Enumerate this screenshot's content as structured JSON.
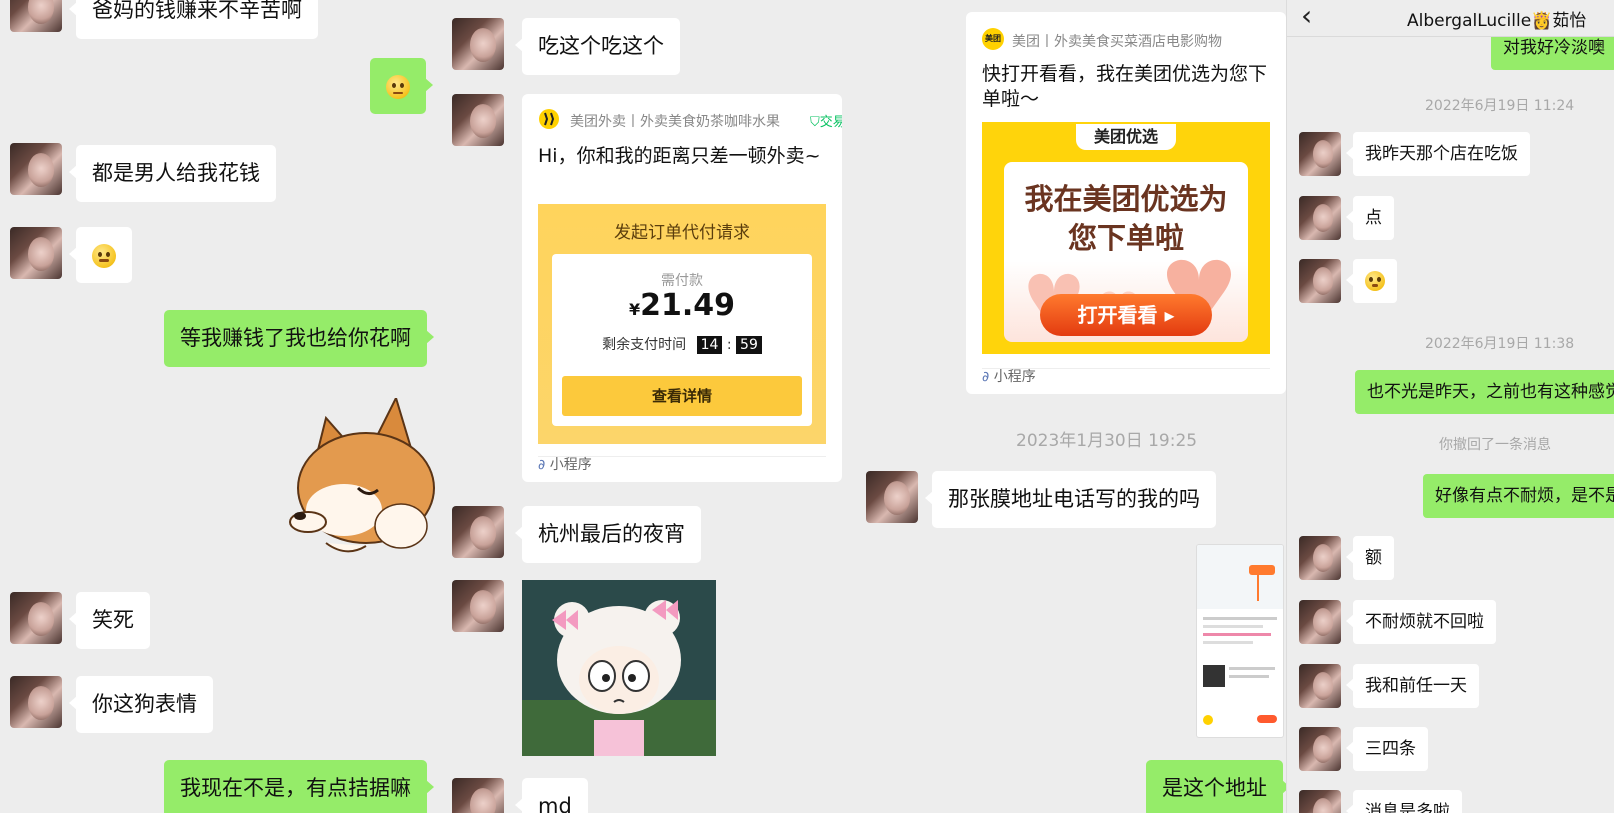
{
  "col1": {
    "messages": [
      {
        "text": "爸妈的钱赚来不辛苦啊"
      },
      {
        "text": "😕"
      },
      {
        "text": "都是男人给我花钱"
      },
      {
        "text": "🙂"
      },
      {
        "text": "等我赚钱了我也给你花啊"
      },
      {
        "text": "笑死"
      },
      {
        "text": "你这狗表情"
      },
      {
        "text": "我现在不是，有点拮据嘛"
      }
    ]
  },
  "col2": {
    "messages": [
      {
        "text": "吃这个吃这个"
      },
      {
        "text": "杭州最后的夜宵"
      },
      {
        "text": "md"
      }
    ],
    "card": {
      "source": "美团外卖丨外卖美食奶茶咖啡水果",
      "verified": "交易",
      "title": "Hi，你和我的距离只差一顿外卖~",
      "panel_title": "发起订单代付请求",
      "amount_label": "需付款",
      "currency": "¥",
      "amount": "21.49",
      "time_label": "剩余支付时间",
      "time_min": "14",
      "time_sep": ":",
      "time_sec": "59",
      "detail_button": "查看详情",
      "footer": "小程序"
    }
  },
  "col3": {
    "card": {
      "source": "美团丨外卖美食买菜酒店电影购物",
      "title": "快打开看看，我在美团优选为您下单啦～",
      "logo_text": "美团",
      "brand": "美团优选",
      "headline_1": "我在美团优选为",
      "headline_2": "您下单啦",
      "open_button": "打开看看",
      "footer": "小程序"
    },
    "timestamp": "2023年1月30日 19:25",
    "messages": [
      {
        "text": "那张膜地址电话写的我的吗"
      },
      {
        "text": "是这个地址"
      }
    ]
  },
  "col4": {
    "header": {
      "title": "AlbergalLucille👸茹怡",
      "back": "‹"
    },
    "messages": [
      {
        "text": "对我好冷淡噢"
      },
      {
        "text": "我昨天那个店在吃饭"
      },
      {
        "text": "点"
      },
      {
        "text": "😳"
      },
      {
        "text": "也不光是昨天，之前也有这种感觉"
      },
      {
        "text": "好像有点不耐烦，是不是"
      },
      {
        "text": "额"
      },
      {
        "text": "不耐烦就不回啦"
      },
      {
        "text": "我和前任一天"
      },
      {
        "text": "三四条"
      },
      {
        "text": "消息是多啦"
      }
    ],
    "timestamps": [
      "2022年6月19日 11:24",
      "2022年6月19日 11:38"
    ],
    "recall": "你撤回了一条消息"
  },
  "colors": {
    "green": "#95ec69",
    "bg": "#ededed",
    "meituan_yellow": "#ffd100",
    "meituan_orange": "#ff6a00"
  }
}
